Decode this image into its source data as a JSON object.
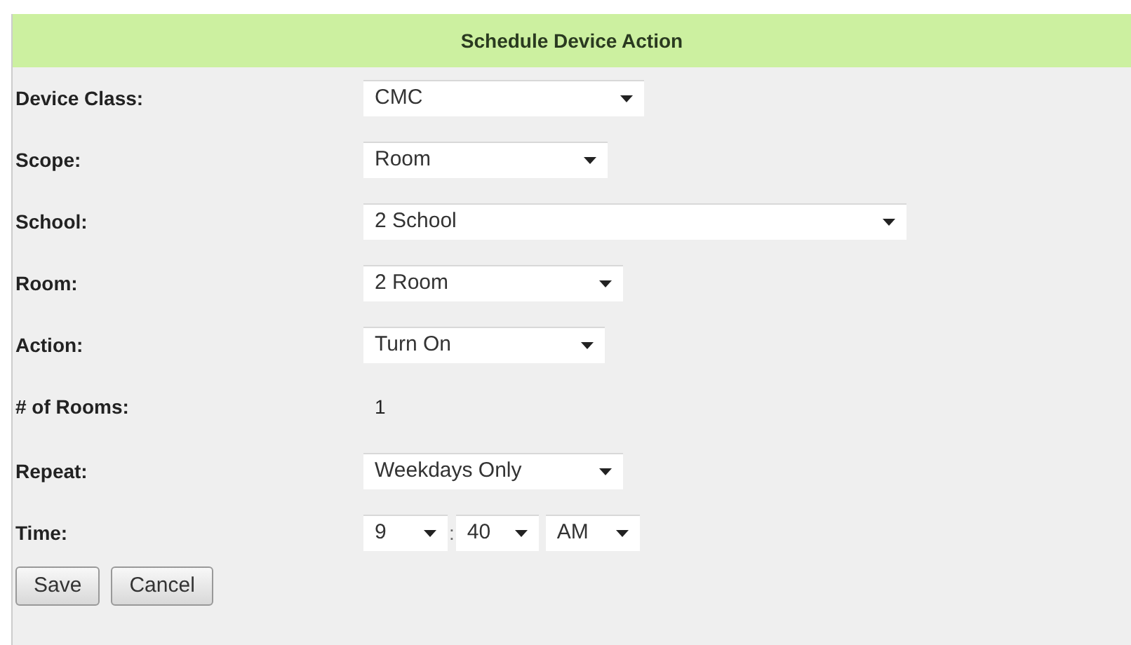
{
  "title": "Schedule Device Action",
  "rows": [
    {
      "kind": "select",
      "label": "Device Class:",
      "value": "CMC"
    },
    {
      "kind": "select",
      "label": "Scope:",
      "value": "Room"
    },
    {
      "kind": "select",
      "label": "School:",
      "value": "2 School"
    },
    {
      "kind": "select",
      "label": "Room:",
      "value": "2 Room"
    },
    {
      "kind": "select",
      "label": "Action:",
      "value": "Turn On"
    },
    {
      "kind": "text",
      "label": "# of Rooms:",
      "value": "1"
    },
    {
      "kind": "select",
      "label": "Repeat:",
      "value": "Weekdays Only"
    },
    {
      "kind": "time",
      "label": "Time:",
      "hour": "9",
      "separator": ":",
      "minute": "40",
      "period": "AM"
    }
  ],
  "buttons": [
    "Save",
    "Cancel"
  ]
}
